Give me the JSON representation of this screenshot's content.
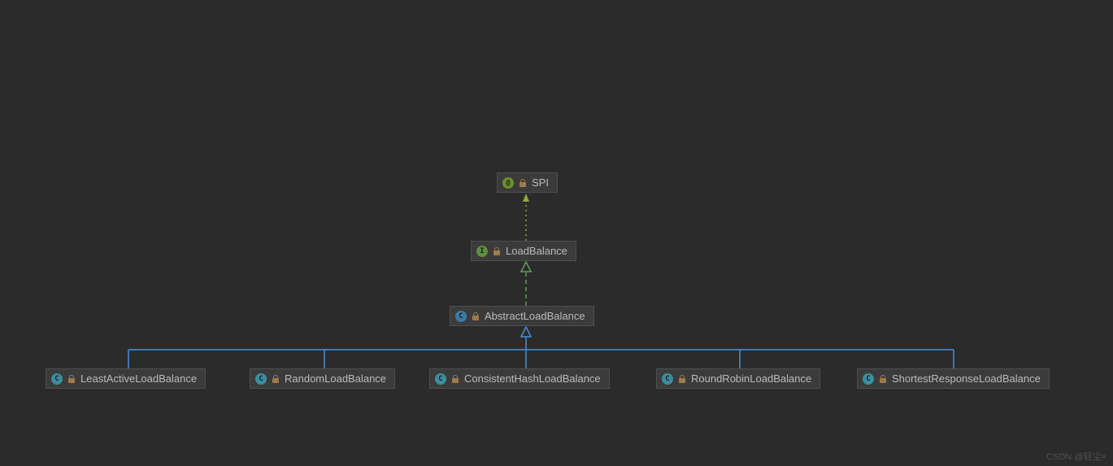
{
  "nodes": {
    "spi": {
      "label": "SPI",
      "icon": "@",
      "type": "annotation"
    },
    "loadbalance": {
      "label": "LoadBalance",
      "icon": "I",
      "type": "interface"
    },
    "abstract": {
      "label": "AbstractLoadBalance",
      "icon": "C",
      "type": "abstract"
    },
    "leastactive": {
      "label": "LeastActiveLoadBalance",
      "icon": "C",
      "type": "class"
    },
    "random": {
      "label": "RandomLoadBalance",
      "icon": "C",
      "type": "class"
    },
    "consistenthash": {
      "label": "ConsistentHashLoadBalance",
      "icon": "C",
      "type": "class"
    },
    "roundrobin": {
      "label": "RoundRobinLoadBalance",
      "icon": "C",
      "type": "class"
    },
    "shortestresponse": {
      "label": "ShortestResponseLoadBalance",
      "icon": "C",
      "type": "class"
    }
  },
  "watermark": "CSDN @轻尘×",
  "chart_data": {
    "type": "table",
    "title": "LoadBalance class hierarchy (UML)",
    "edges": [
      {
        "from": "LoadBalance",
        "to": "SPI",
        "relation": "annotated-by",
        "style": "dotted"
      },
      {
        "from": "AbstractLoadBalance",
        "to": "LoadBalance",
        "relation": "implements",
        "style": "dashed"
      },
      {
        "from": "LeastActiveLoadBalance",
        "to": "AbstractLoadBalance",
        "relation": "extends",
        "style": "solid"
      },
      {
        "from": "RandomLoadBalance",
        "to": "AbstractLoadBalance",
        "relation": "extends",
        "style": "solid"
      },
      {
        "from": "ConsistentHashLoadBalance",
        "to": "AbstractLoadBalance",
        "relation": "extends",
        "style": "solid"
      },
      {
        "from": "RoundRobinLoadBalance",
        "to": "AbstractLoadBalance",
        "relation": "extends",
        "style": "solid"
      },
      {
        "from": "ShortestResponseLoadBalance",
        "to": "AbstractLoadBalance",
        "relation": "extends",
        "style": "solid"
      }
    ]
  }
}
